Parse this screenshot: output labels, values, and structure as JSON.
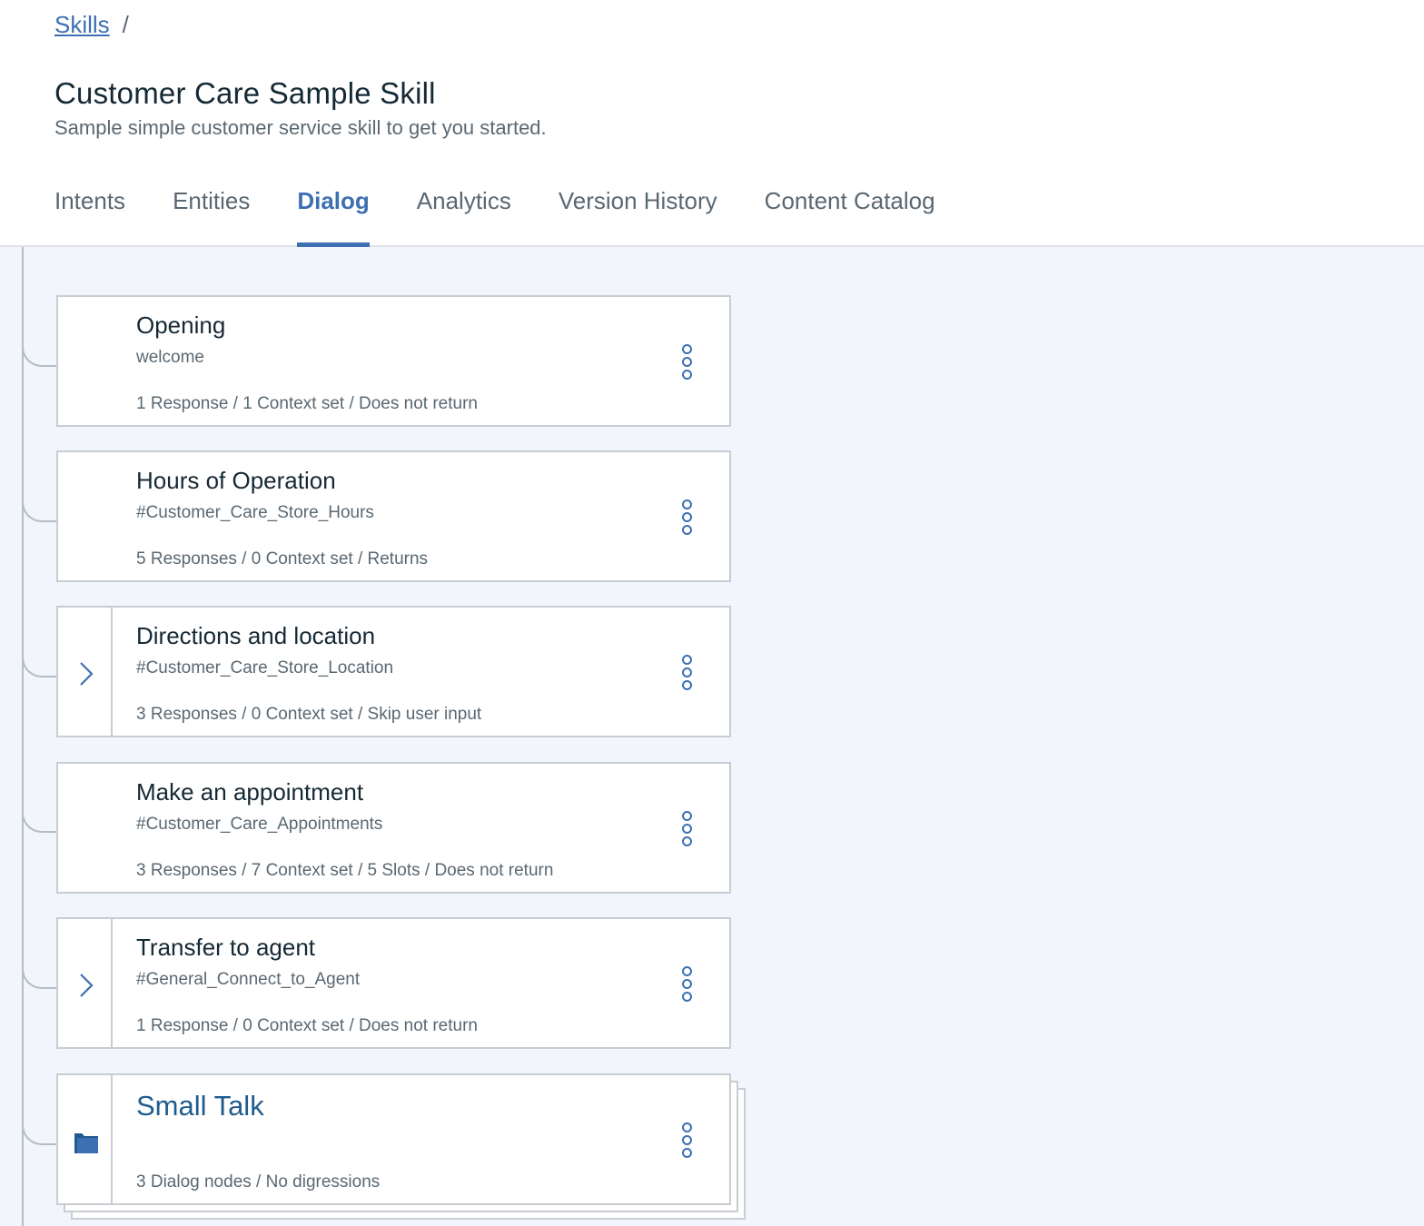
{
  "breadcrumb": {
    "link": "Skills",
    "separator": "/"
  },
  "header": {
    "title": "Customer Care Sample Skill",
    "subtitle": "Sample simple customer service skill to get you started."
  },
  "tabs": [
    {
      "label": "Intents"
    },
    {
      "label": "Entities"
    },
    {
      "label": "Dialog",
      "active": true
    },
    {
      "label": "Analytics"
    },
    {
      "label": "Version History"
    },
    {
      "label": "Content Catalog"
    }
  ],
  "nodes": [
    {
      "name": "Opening",
      "condition": "welcome",
      "meta": "1 Response / 1 Context set / Does not return",
      "expandable": false
    },
    {
      "name": "Hours of Operation",
      "condition": "#Customer_Care_Store_Hours",
      "meta": "5 Responses / 0 Context set / Returns",
      "expandable": false
    },
    {
      "name": "Directions and location",
      "condition": "#Customer_Care_Store_Location",
      "meta": "3 Responses / 0 Context set / Skip user input",
      "expandable": true
    },
    {
      "name": "Make an appointment",
      "condition": "#Customer_Care_Appointments",
      "meta": "3 Responses / 7 Context set / 5 Slots / Does not return",
      "expandable": false
    },
    {
      "name": "Transfer to agent",
      "condition": "#General_Connect_to_Agent",
      "meta": "1 Response / 0 Context set / Does not return",
      "expandable": true
    },
    {
      "name": "Small Talk",
      "condition": "",
      "meta": "3 Dialog nodes / No digressions",
      "folder": true
    }
  ],
  "colors": {
    "accent": "#3d70b2",
    "canvas": "#f2f6fc",
    "folder": "#1f5b8e"
  },
  "icons": {
    "expand": "chevron-right-icon",
    "menu": "overflow-menu-icon",
    "folder": "folder-icon"
  }
}
